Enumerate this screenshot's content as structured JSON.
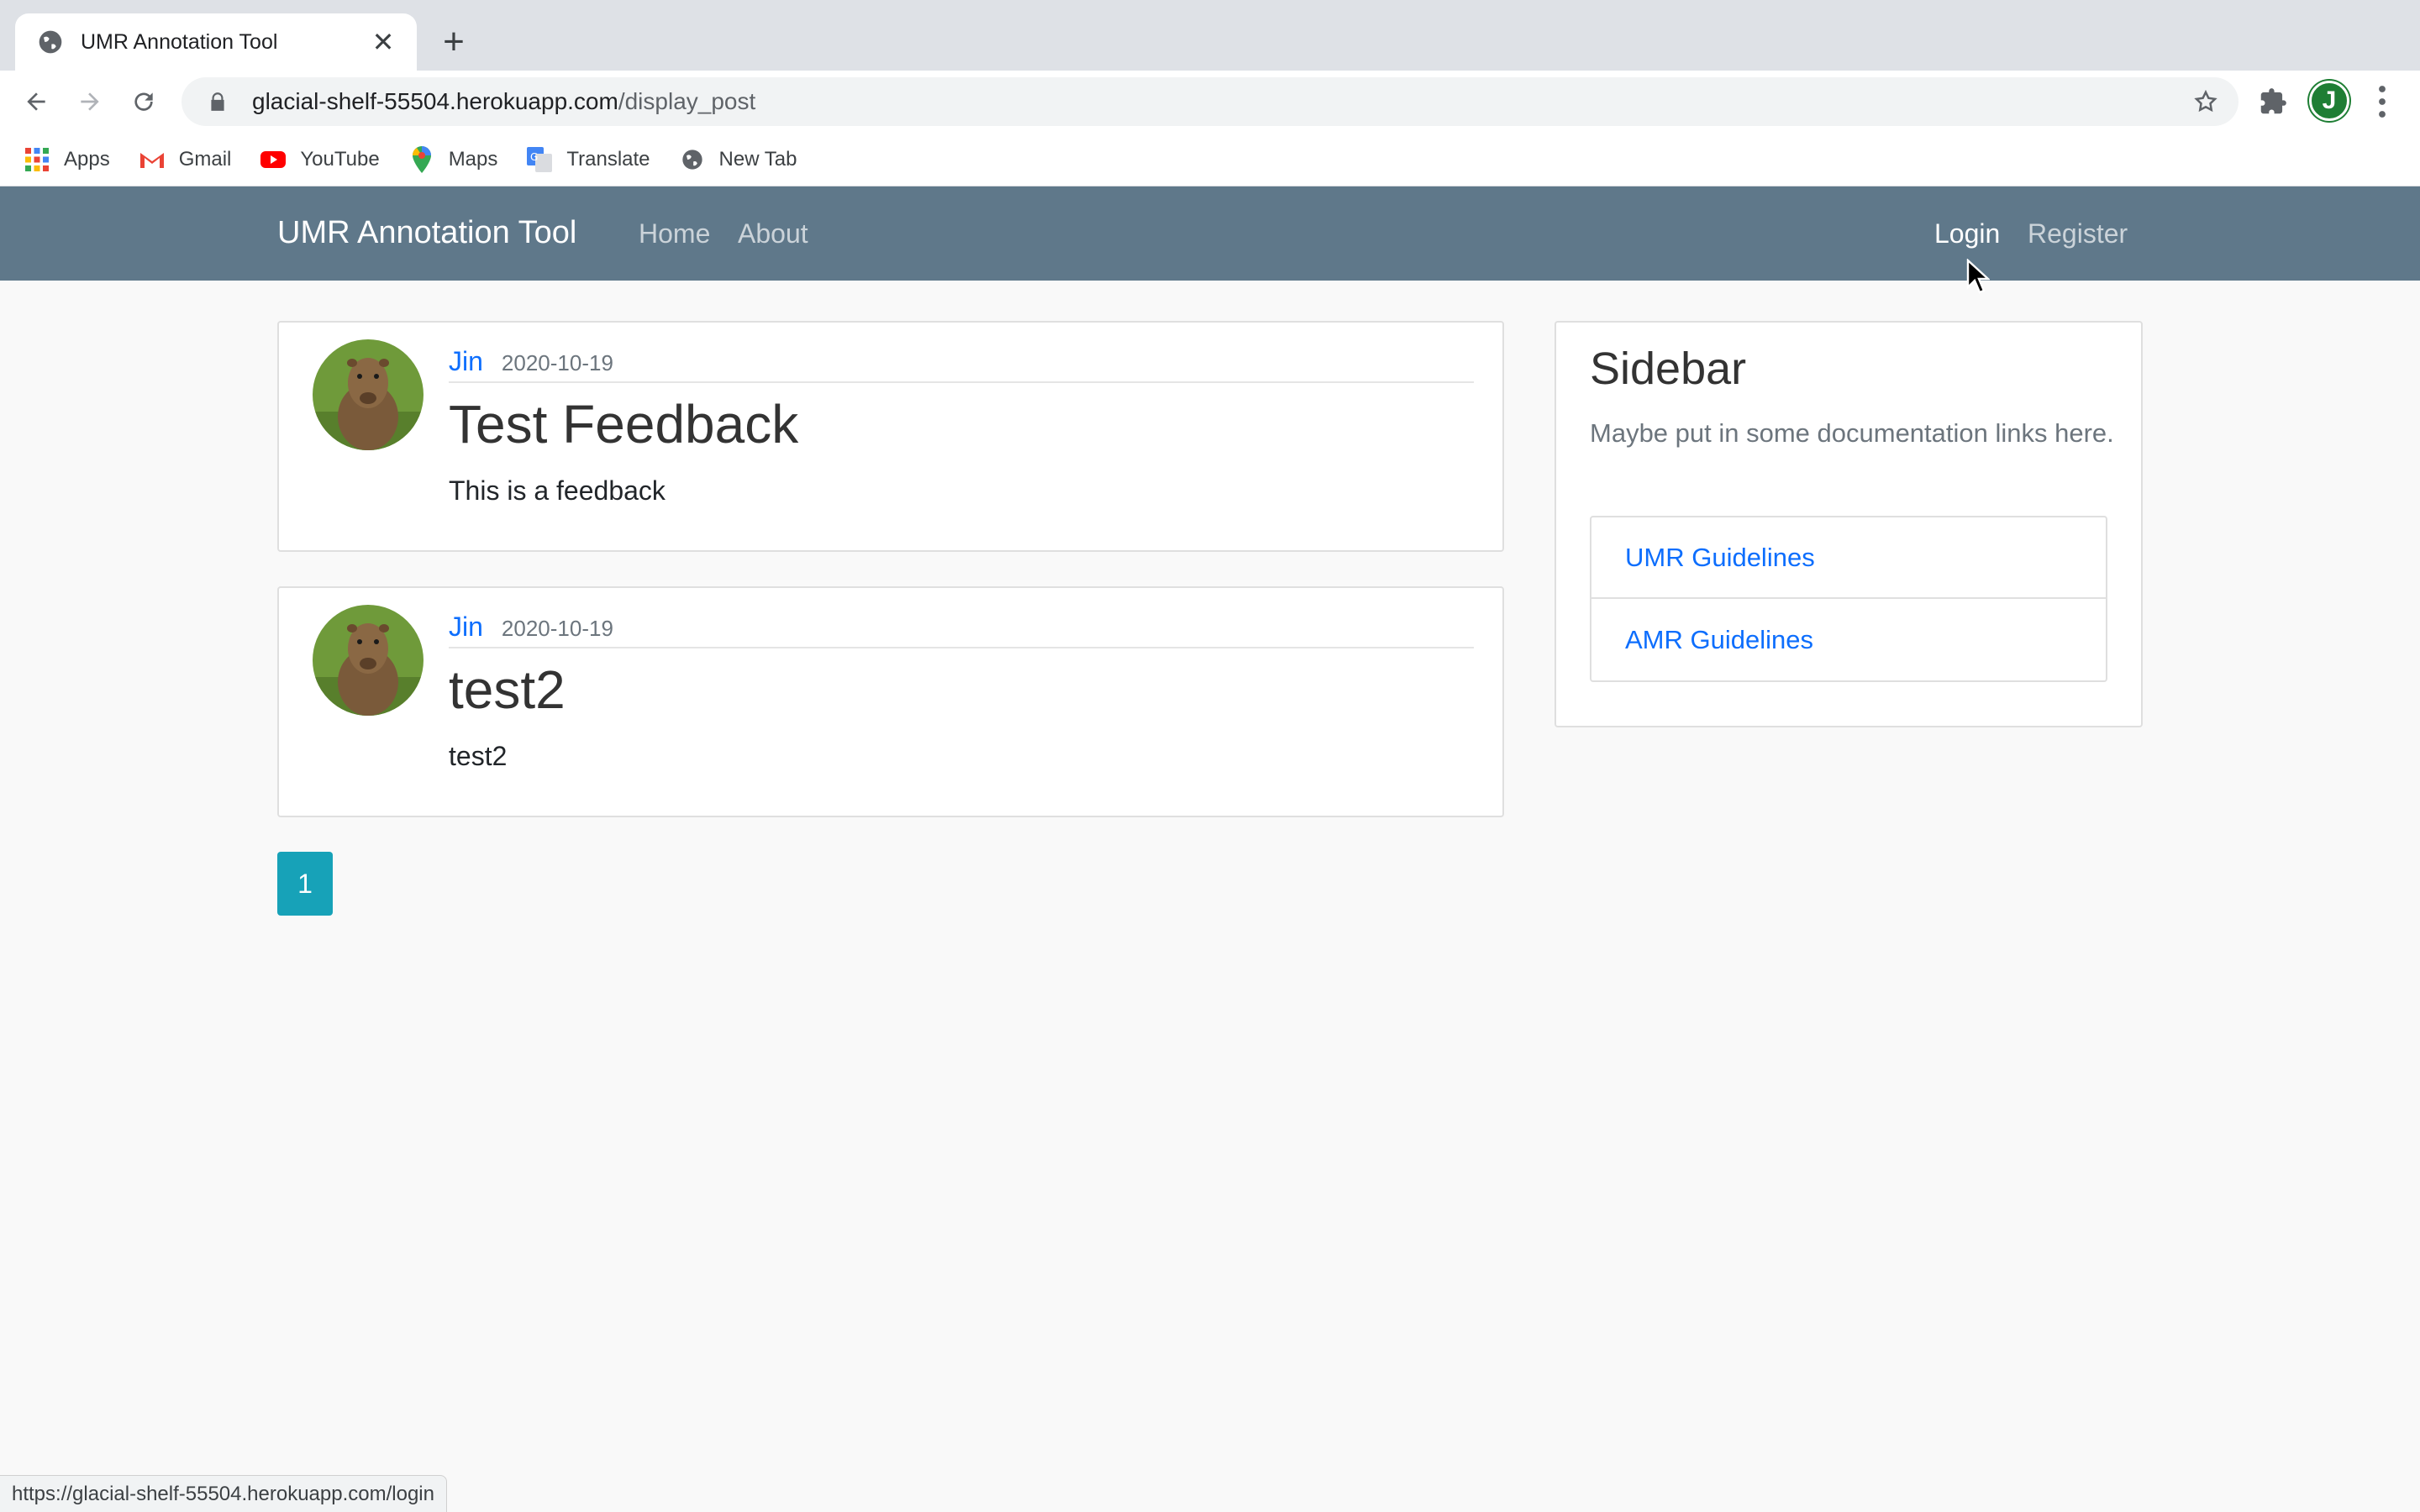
{
  "browser": {
    "tab_title": "UMR Annotation Tool",
    "url_host": "glacial-shelf-55504.herokuapp.com",
    "url_path": "/display_post",
    "profile_initial": "J",
    "status_url": "https://glacial-shelf-55504.herokuapp.com/login"
  },
  "bookmarks": [
    {
      "label": "Apps",
      "icon": "apps-grid-icon"
    },
    {
      "label": "Gmail",
      "icon": "gmail-icon"
    },
    {
      "label": "YouTube",
      "icon": "youtube-icon"
    },
    {
      "label": "Maps",
      "icon": "maps-pin-icon"
    },
    {
      "label": "Translate",
      "icon": "translate-icon"
    },
    {
      "label": "New Tab",
      "icon": "globe-icon"
    }
  ],
  "navbar": {
    "brand": "UMR Annotation Tool",
    "links": [
      "Home",
      "About"
    ],
    "right_links": [
      "Login",
      "Register"
    ],
    "background": "#5f788a"
  },
  "posts": [
    {
      "author": "Jin",
      "date": "2020-10-19",
      "title": "Test Feedback",
      "body": "This is a feedback"
    },
    {
      "author": "Jin",
      "date": "2020-10-19",
      "title": "test2",
      "body": "test2"
    }
  ],
  "sidebar": {
    "title": "Sidebar",
    "text": "Maybe put in some documentation links here.",
    "links": [
      "UMR Guidelines",
      "AMR Guidelines"
    ]
  },
  "pagination": {
    "current": "1",
    "color": "#17a2b8"
  }
}
